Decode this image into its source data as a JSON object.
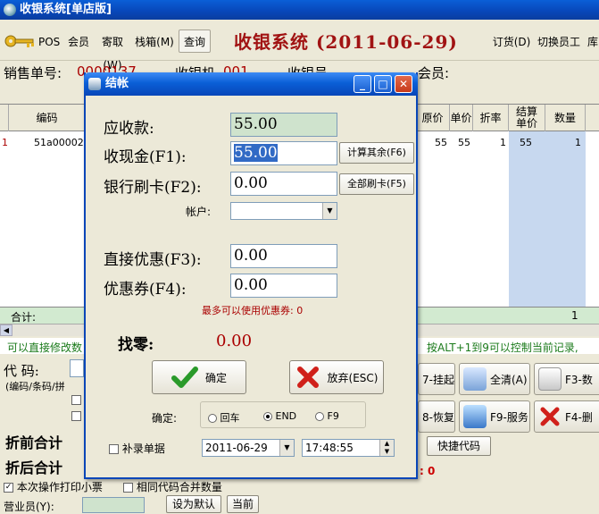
{
  "window": {
    "title": "收银系统[单店版]"
  },
  "toolbar": {
    "pos_label": "POS",
    "member_label": "会员",
    "register_label": "寄取(W)",
    "stack_label": "栈箱(M)",
    "query_label": "查询",
    "heading": "收银系统 (2011-06-29)",
    "order_label": "订货(D)",
    "switch_staff_label": "切换员工",
    "stock_label": "库存"
  },
  "info": {
    "order_no_label": "销售单号:",
    "order_no_value": "0000137",
    "register_label": "收银机",
    "register_value": "001",
    "cashier_label": "收银员",
    "member_label": "会员:"
  },
  "grid": {
    "headers": [
      "编码",
      "原价",
      "单价",
      "折率",
      "结算单价",
      "数量"
    ],
    "row": {
      "marker": "1",
      "code": "51a00002",
      "original_price": "55",
      "unit_price": "55",
      "discount_rate": "1",
      "settle_price": "55",
      "quantity": "1"
    },
    "total_label": "合计:",
    "total_quantity": "1"
  },
  "hint": {
    "left": "可以直接修改数",
    "right": "按ALT+1到9可以控制当前记录,"
  },
  "lower": {
    "code_label": "代  码:",
    "code_hint": "(编码/条码/拼",
    "before_total_label": "折前合计",
    "after_total_label": "折后合计",
    "print_receipt_label": "本次操作打印小票",
    "merge_qty_label": "相同代码合并数量",
    "salesperson_label": "营业员(Y):",
    "set_default_label": "设为默认",
    "current_label": "当前",
    "hang_label": "7-挂起",
    "clear_label": "全清(A)",
    "f3_label": "F3-数",
    "restore_label": "8-恢复",
    "f9_label": "F9-服务",
    "f4_label": "F4-删",
    "quick_code_label": "快捷代码",
    "red_zero": ": 0"
  },
  "dialog": {
    "title": "结帐",
    "receivable_label": "应收款:",
    "receivable_value": "55.00",
    "cash_label": "收现金(F1):",
    "cash_value": "55.00",
    "calc_rest_label": "计算其余(F6)",
    "card_label": "银行刷卡(F2):",
    "card_value": "0.00",
    "all_card_label": "全部刷卡(F5)",
    "account_label": "帐户:",
    "account_value": "",
    "direct_discount_label": "直接优惠(F3):",
    "direct_discount_value": "0.00",
    "coupon_label": "优惠券(F4):",
    "coupon_value": "0.00",
    "coupon_max_note": "最多可以使用优惠券: 0",
    "change_label": "找零:",
    "change_value": "0.00",
    "confirm_label": "确定",
    "cancel_label": "放弃(ESC)",
    "confirm_key_label": "确定:",
    "opt_enter": "回车",
    "opt_end": "END",
    "opt_f9": "F9",
    "selected_key": "END",
    "backfill_label": "补录单据",
    "date_value": "2011-06-29",
    "time_value": "17:48:55"
  },
  "colors": {
    "heading_red": "#a11313",
    "readonly_green": "#cfe3cd",
    "selected_col_blue": "#c7d8ef",
    "change_red": "#a00000"
  }
}
